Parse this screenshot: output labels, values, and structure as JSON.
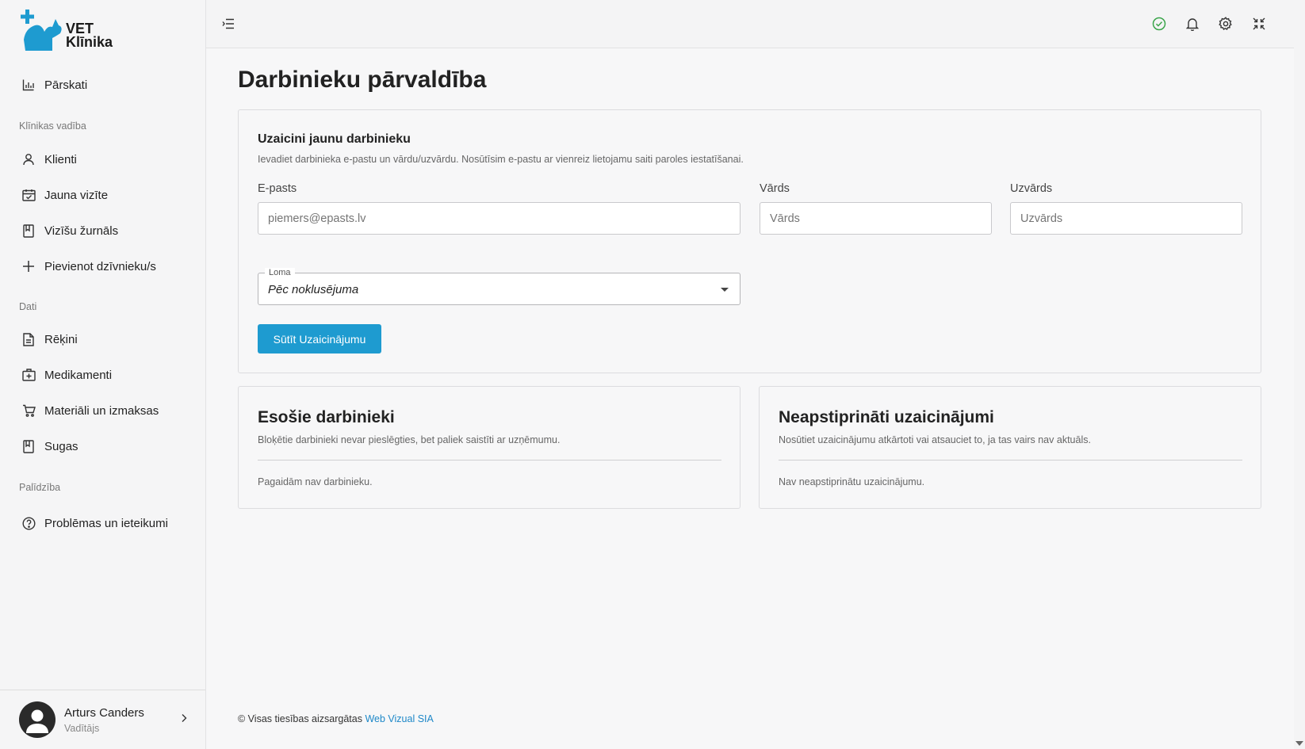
{
  "brand": {
    "line1": "VET",
    "line2": "Klīnika",
    "accent": "#1e9bd0"
  },
  "sidebar": {
    "top_item": {
      "label": "Pārskati",
      "icon": "bar-chart-icon"
    },
    "sections": [
      {
        "title": "Klīnikas vadība"
      },
      {
        "title": "Dati"
      },
      {
        "title": "Palīdzība"
      }
    ],
    "items": [
      {
        "label": "Klienti",
        "icon": "user-icon"
      },
      {
        "label": "Jauna vizīte",
        "icon": "calendar-icon"
      },
      {
        "label": "Vizīšu žurnāls",
        "icon": "book-icon"
      },
      {
        "label": "Pievienot dzīvnieku/s",
        "icon": "plus-icon"
      },
      {
        "label": "Rēķini",
        "icon": "document-icon"
      },
      {
        "label": "Medikamenti",
        "icon": "medkit-icon"
      },
      {
        "label": "Materiāli un izmaksas",
        "icon": "cart-icon"
      },
      {
        "label": "Sugas",
        "icon": "book-icon"
      },
      {
        "label": "Problēmas un ieteikumi",
        "icon": "help-circle-icon"
      }
    ],
    "user": {
      "name": "Arturs Canders",
      "role": "Vadītājs"
    }
  },
  "page": {
    "title": "Darbinieku pārvaldība"
  },
  "invite": {
    "title": "Uzaicini jaunu darbinieku",
    "description": "Ievadiet darbinieka e-pastu un vārdu/uzvārdu. Nosūtīsim e-pastu ar vienreiz lietojamu saiti paroles iestatīšanai.",
    "email_label": "E-pasts",
    "email_placeholder": "piemers@epasts.lv",
    "first_label": "Vārds",
    "first_placeholder": "Vārds",
    "last_label": "Uzvārds",
    "last_placeholder": "Uzvārds",
    "role_legend": "Loma",
    "role_value": "Pēc noklusējuma",
    "submit_label": "Sūtīt Uzaicinājumu"
  },
  "employees": {
    "title": "Esošie darbinieki",
    "description": "Bloķētie darbinieki nevar pieslēgties, bet paliek saistīti ar uzņēmumu.",
    "empty": "Pagaidām nav darbinieku."
  },
  "pending": {
    "title": "Neapstiprināti uzaicinājumi",
    "description": "Nosūtiet uzaicinājumu atkārtoti vai atsauciet to, ja tas vairs nav aktuāls.",
    "empty": "Nav neapstiprinātu uzaicinājumu."
  },
  "footer": {
    "text": "© Visas tiesības aizsargātas",
    "link": "Web Vizual SIA"
  }
}
